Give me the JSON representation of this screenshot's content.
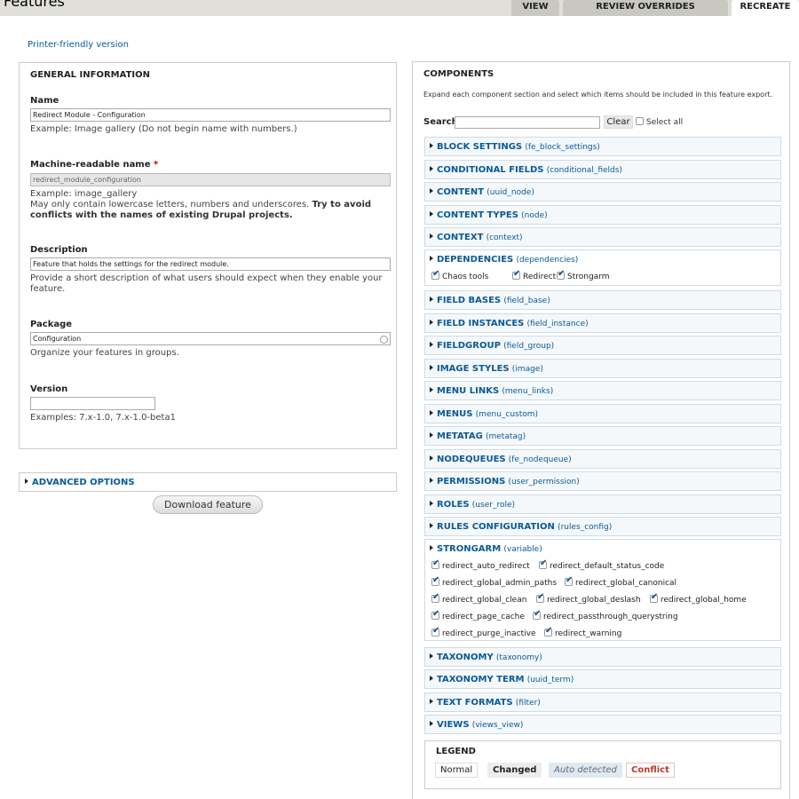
{
  "page": {
    "title": "Features",
    "tabs": [
      "VIEW",
      "REVIEW OVERRIDES",
      "RECREATE"
    ],
    "printer_link": "Printer-friendly version"
  },
  "general": {
    "legend": "GENERAL INFORMATION",
    "name_label": "Name",
    "name_value": "Redirect Module - Configuration",
    "name_desc": "Example: Image gallery (Do not begin name with numbers.)",
    "machine_label": "Machine-readable name",
    "required_mark": "*",
    "machine_value": "redirect_module_configuration",
    "machine_desc_1": "Example: image_gallery",
    "machine_desc_2": "May only contain lowercase letters, numbers and underscores.",
    "machine_desc_bold": "Try to avoid conflicts with the names of existing Drupal projects.",
    "description_label": "Description",
    "description_value": "Feature that holds the settings for the redirect module.",
    "description_desc": "Provide a short description of what users should expect when they enable your feature.",
    "package_label": "Package",
    "package_value": "Configuration",
    "package_desc": "Organize your features in groups.",
    "version_label": "Version",
    "version_value": "",
    "version_desc": "Examples: 7.x-1.0, 7.x-1.0-beta1"
  },
  "advanced": {
    "label": "ADVANCED OPTIONS"
  },
  "download_label": "Download feature",
  "components": {
    "legend": "COMPONENTS",
    "description": "Expand each component section and select which items should be included in this feature export.",
    "search_label": "Search",
    "search_value": "",
    "clear_label": "Clear",
    "select_all_label": "Select all",
    "sections": [
      {
        "name": "BLOCK SETTINGS",
        "machine": "(fe_block_settings)"
      },
      {
        "name": "CONDITIONAL FIELDS",
        "machine": "(conditional_fields)"
      },
      {
        "name": "CONTENT",
        "machine": "(uuid_node)"
      },
      {
        "name": "CONTENT TYPES",
        "machine": "(node)"
      },
      {
        "name": "CONTEXT",
        "machine": "(context)"
      },
      {
        "name": "DEPENDENCIES",
        "machine": "(dependencies)"
      },
      {
        "name": "FIELD BASES",
        "machine": "(field_base)"
      },
      {
        "name": "FIELD INSTANCES",
        "machine": "(field_instance)"
      },
      {
        "name": "FIELDGROUP",
        "machine": "(field_group)"
      },
      {
        "name": "IMAGE STYLES",
        "machine": "(image)"
      },
      {
        "name": "MENU LINKS",
        "machine": "(menu_links)"
      },
      {
        "name": "MENUS",
        "machine": "(menu_custom)"
      },
      {
        "name": "METATAG",
        "machine": "(metatag)"
      },
      {
        "name": "NODEQUEUES",
        "machine": "(fe_nodequeue)"
      },
      {
        "name": "PERMISSIONS",
        "machine": "(user_permission)"
      },
      {
        "name": "ROLES",
        "machine": "(user_role)"
      },
      {
        "name": "RULES CONFIGURATION",
        "machine": "(rules_config)"
      },
      {
        "name": "STRONGARM",
        "machine": "(variable)"
      },
      {
        "name": "TAXONOMY",
        "machine": "(taxonomy)"
      },
      {
        "name": "TAXONOMY TERM",
        "machine": "(uuid_term)"
      },
      {
        "name": "TEXT FORMATS",
        "machine": "(filter)"
      },
      {
        "name": "VIEWS",
        "machine": "(views_view)"
      }
    ],
    "dependencies_items": [
      "Chaos tools",
      "Redirect",
      "Strongarm"
    ],
    "strongarm_items": [
      "redirect_auto_redirect",
      "redirect_default_status_code",
      "redirect_global_admin_paths",
      "redirect_global_canonical",
      "redirect_global_clean",
      "redirect_global_deslash",
      "redirect_global_home",
      "redirect_page_cache",
      "redirect_passthrough_querystring",
      "redirect_purge_inactive",
      "redirect_warning"
    ]
  },
  "legend": {
    "title": "LEGEND",
    "normal": "Normal",
    "changed": "Changed",
    "auto": "Auto detected",
    "conflict": "Conflict"
  }
}
